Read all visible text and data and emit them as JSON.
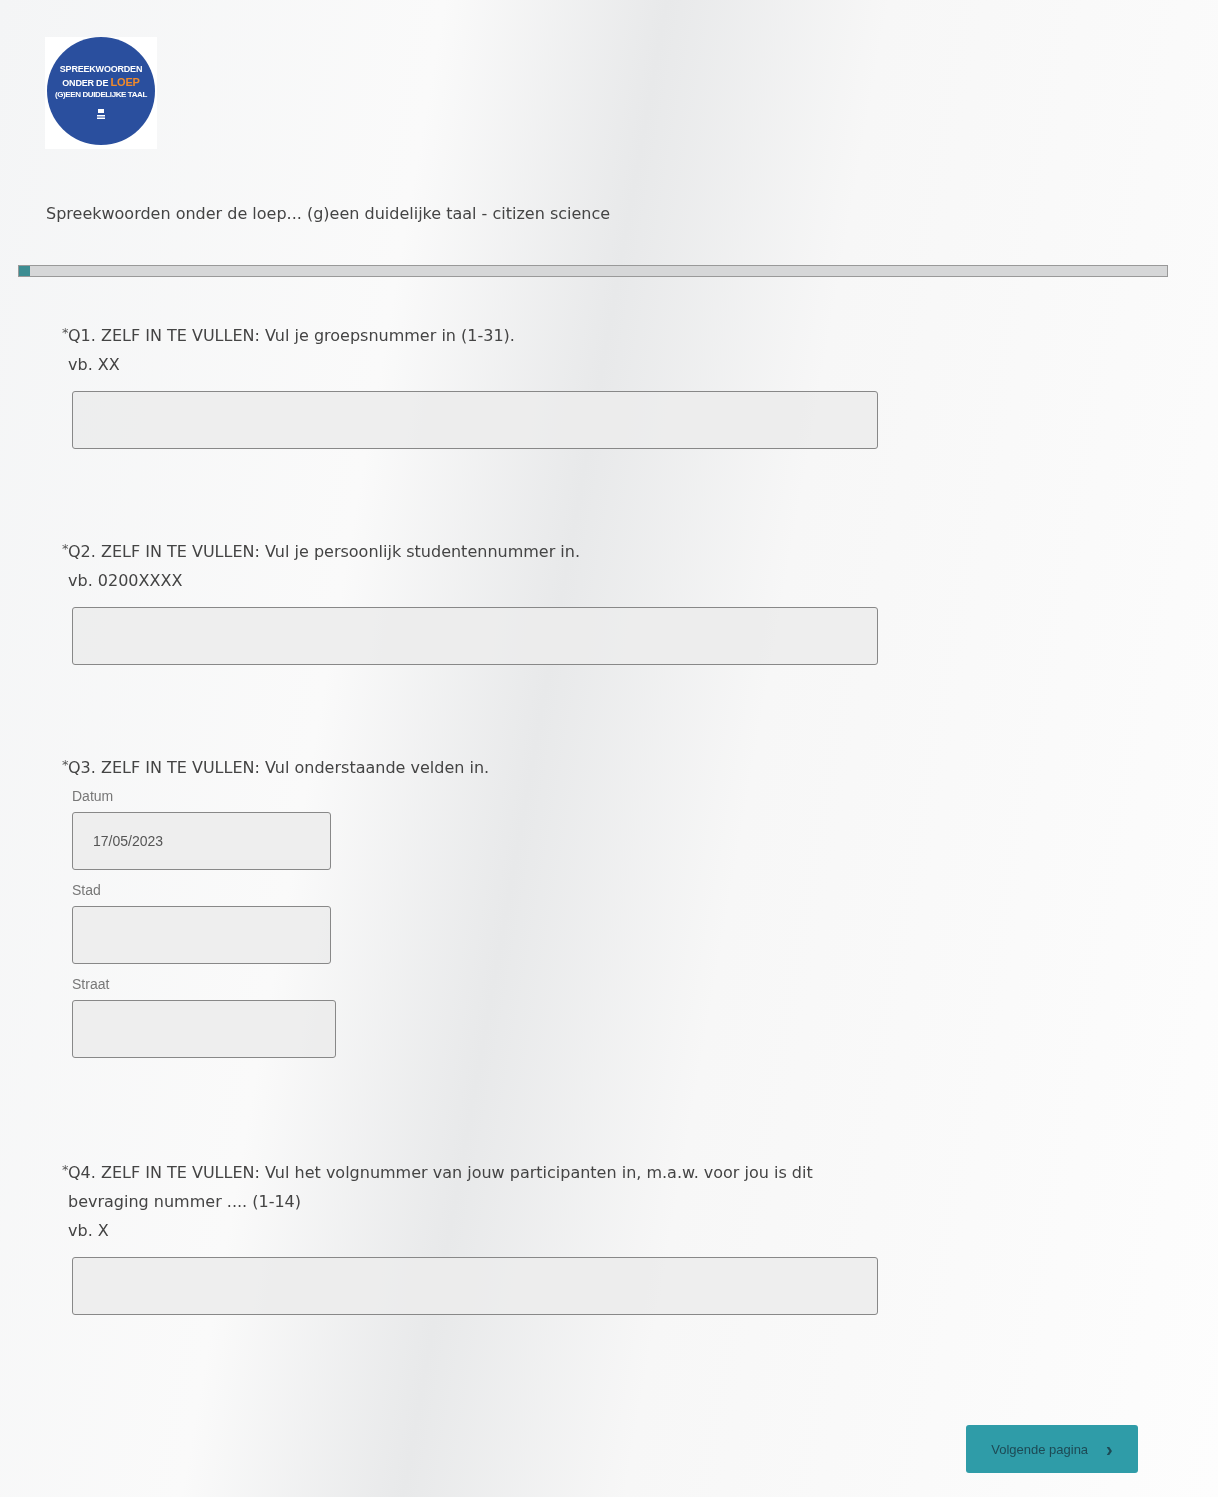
{
  "logo": {
    "line_1": "SPREEKWOORDEN",
    "line_2": "ONDER DE",
    "line_2_highlight": "LOEP",
    "line_3": "(G)EEN DUIDELIJKE TAAL"
  },
  "survey_title": "Spreekwoorden onder de loep... (g)een duidelijke taal - citizen science",
  "progress": {
    "level": 0.01
  },
  "questions": [
    {
      "kind": "text",
      "required_mark": "*",
      "label": "Q1. ZELF IN TE VULLEN: Vul je groepsnummer in (1-31).",
      "hint": "vb. XX"
    },
    {
      "kind": "text",
      "required_mark": "*",
      "label": "Q2. ZELF IN TE VULLEN: Vul je persoonlijk studentennummer in.",
      "hint": "vb. 0200XXXX"
    },
    {
      "kind": "fields",
      "required_mark": "*",
      "label": "Q3. ZELF IN TE VULLEN: Vul onderstaande velden in.",
      "fields": [
        {
          "label": "Datum",
          "value": "17/05/2023"
        },
        {
          "label": "Stad"
        },
        {
          "label": "Straat"
        }
      ]
    },
    {
      "kind": "text",
      "required_mark": "*",
      "label": "Q4. ZELF IN TE VULLEN: Vul het volgnummer van jouw participanten in, m.a.w. voor jou is dit bevraging nummer .... (1-14)",
      "hint": "vb. X"
    }
  ],
  "next_button": {
    "label": "Volgende pagina",
    "icon": "›"
  }
}
